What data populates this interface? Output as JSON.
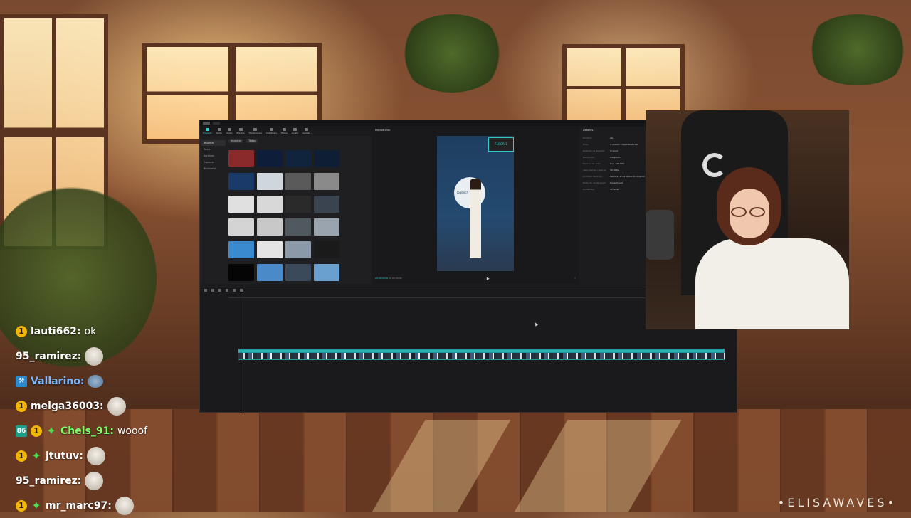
{
  "editor": {
    "tools": [
      "Proyecto",
      "Texto",
      "Audio",
      "Efectos",
      "Transiciones",
      "Subtítulos",
      "Filtros",
      "Ajuste",
      "Ajustes"
    ],
    "media": {
      "side_items": [
        "Importar",
        "Yours",
        "Archivos",
        "Espacios",
        "Biblioteca"
      ],
      "import_label": "Importar",
      "header_label": "Todos"
    },
    "player": {
      "title": "Reproductor",
      "sign_text": "FLOOR 1",
      "brand_text": "logitech",
      "time_label": "00:00:00:00",
      "duration_label": "00:05:20:00"
    },
    "details": {
      "title": "Detalles",
      "rows": [
        {
          "k": "Nombre:",
          "v": "0G.."
        },
        {
          "k": "Ruta:",
          "v": "C:/Users/.../AppData/Local"
        },
        {
          "k": "Relación de aspecto:",
          "v": "Original"
        },
        {
          "k": "Resolución:",
          "v": "Adaptado"
        },
        {
          "k": "Espacio de color:",
          "v": "Rec. 709 SDR"
        },
        {
          "k": "Velocidad de cuadros:",
          "v": "30.00fps"
        },
        {
          "k": "Archivos de proxy:",
          "v": "Recortar en la ubicación original"
        },
        {
          "k": "Modo de renderizado:",
          "v": "Desactivado"
        },
        {
          "k": "Renderizar:",
          "v": "Activado"
        }
      ]
    }
  },
  "chat": [
    {
      "badges": [
        "1"
      ],
      "user": "lauti662:",
      "text": "ok",
      "color": "white"
    },
    {
      "badges": [],
      "user": "95_ramirez:",
      "emote": "rat",
      "color": "white"
    },
    {
      "badges": [
        "hammer"
      ],
      "user": "Vallarino:",
      "emote": "fish",
      "color": "blue"
    },
    {
      "badges": [
        "1"
      ],
      "user": "meiga36003:",
      "emote": "rat",
      "color": "white"
    },
    {
      "badges": [
        "sq",
        "1",
        "star"
      ],
      "user": "Cheis_91:",
      "text": "wooof",
      "color": "green"
    },
    {
      "badges": [
        "1",
        "star"
      ],
      "user": "jtutuv:",
      "emote": "rat",
      "color": "white"
    },
    {
      "badges": [],
      "user": "95_ramirez:",
      "emote": "rat",
      "color": "white"
    },
    {
      "badges": [
        "1",
        "star"
      ],
      "user": "mr_marc97:",
      "emote": "rat",
      "color": "white"
    }
  ],
  "brand": "ELISAWAVES"
}
